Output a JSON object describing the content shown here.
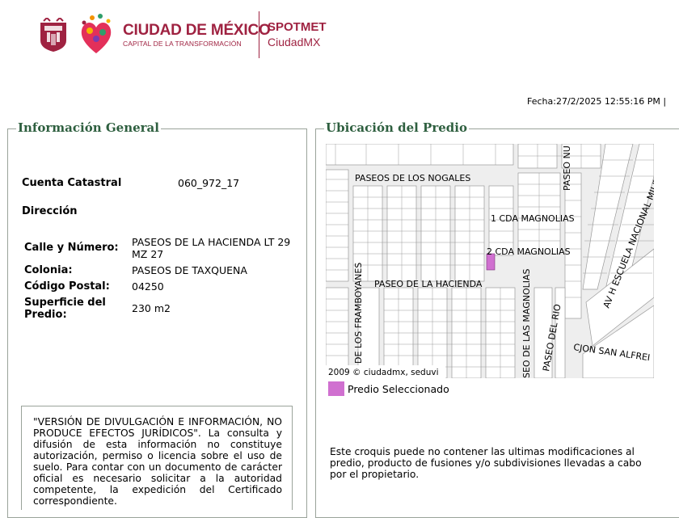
{
  "header": {
    "brand_title": "CIUDAD DE MÉXICO",
    "brand_subtitle": "CAPITAL DE LA TRANSFORMACIÓN",
    "system_title": "SPOTMET",
    "system_subtitle": "CiudadMX",
    "brand_color": "#9f2241"
  },
  "fecha": "Fecha:27/2/2025 12:55:16 PM |",
  "info": {
    "legend": "Información General",
    "cuenta_label": "Cuenta Catastral",
    "cuenta_value": "060_972_17",
    "direccion_label": "Dirección",
    "calle_label": "Calle y Número:",
    "calle_value": "PASEOS DE LA HACIENDA LT 29 MZ 27",
    "colonia_label": "Colonia:",
    "colonia_value": "PASEOS DE TAXQUENA",
    "cp_label": "Código Postal:",
    "cp_value": "04250",
    "superficie_label": "Superficie del Predio:",
    "superficie_value": "230 m2",
    "notice": "\"VERSIÓN DE DIVULGACIÓN E INFORMACIÓN, NO PRODUCE EFECTOS JURÍDICOS\". La consulta y difusión de esta información no constituye autorización, permiso o licencia sobre el uso de suelo. Para contar con un documento de carácter oficial es necesario solicitar a la autoridad competente, la expedición del Certificado correspondiente."
  },
  "ubicacion": {
    "legend": "Ubicación del Predio",
    "map": {
      "streets": {
        "nogales": "PASEOS DE LOS NOGALES",
        "paseo_nu": "PASEO NU",
        "militar": "AV H ESCUELA NACIONAL MILITAR",
        "cda1": "1 CDA MAGNOLIAS",
        "cda2": "2 CDA MAGNOLIAS",
        "hacienda": "PASEO DE LA HACIENDA",
        "framboyanes": "DE LOS FRAMBOYANES",
        "magnolias": "SEO DE LAS MAGNOLIAS",
        "rio": "PASEO DEL RIO",
        "alfre": "CJON SAN ALFREI"
      },
      "copyright": "2009 © ciudadmx, seduvi"
    },
    "legend_item": "Predio Seleccionado",
    "selected_color": "#d070d0",
    "croquis_note": "Este croquis puede no contener las ultimas modificaciones al predio, producto de fusiones y/o subdivisiones llevadas a cabo por el propietario."
  }
}
